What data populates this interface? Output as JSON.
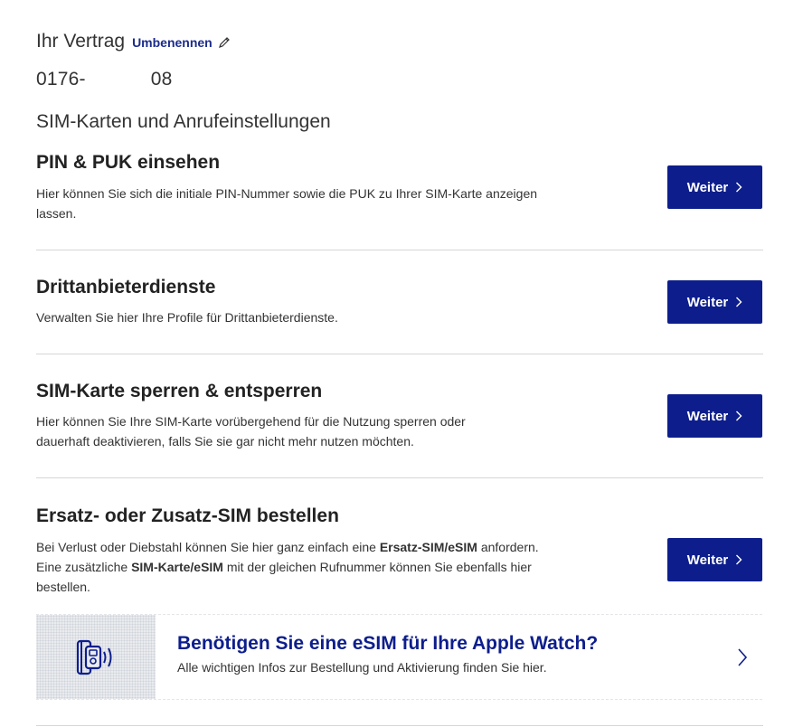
{
  "header": {
    "title": "Ihr Vertrag",
    "rename_label": "Umbenennen",
    "number_prefix": "0176-",
    "number_suffix": "08",
    "section_title": "SIM-Karten und Anrufeinstellungen"
  },
  "items": [
    {
      "title": "PIN & PUK einsehen",
      "desc": "Hier können Sie sich die initiale PIN-Nummer sowie die PUK zu Ihrer SIM-Karte anzeigen lassen.",
      "button": "Weiter"
    },
    {
      "title": "Drittanbieterdienste",
      "desc": "Verwalten Sie hier Ihre Profile für Drittanbieterdienste.",
      "button": "Weiter"
    },
    {
      "title": "SIM-Karte sperren & entsperren",
      "desc": "Hier können Sie Ihre SIM-Karte vorübergehend für die Nutzung sperren oder dauerhaft deaktivieren, falls Sie sie gar nicht mehr nutzen möchten.",
      "button": "Weiter"
    },
    {
      "title": "Ersatz- oder Zusatz-SIM bestellen",
      "desc_p1_a": "Bei Verlust oder Diebstahl können Sie hier ganz einfach eine ",
      "desc_p1_b": "Ersatz-SIM/eSIM",
      "desc_p1_c": " anfordern.",
      "desc_p2_a": "Eine zusätzliche ",
      "desc_p2_b": "SIM-Karte/eSIM",
      "desc_p2_c": " mit der gleichen Rufnummer können Sie ebenfalls hier bestellen.",
      "button": "Weiter"
    }
  ],
  "banner": {
    "heading": "Benötigen Sie eine eSIM für Ihre Apple Watch?",
    "sub": "Alle wichtigen Infos zur Bestellung und Aktivierung finden Sie hier.",
    "icon": "smartwatch-esim-icon"
  },
  "colors": {
    "primary": "#0d1e8c",
    "divider": "#d4d6db",
    "text": "#333333"
  }
}
